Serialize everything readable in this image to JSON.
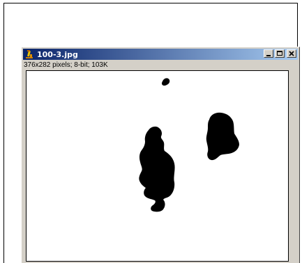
{
  "window": {
    "title": "100-3.jpg",
    "info": "376x282 pixels; 8-bit; 103K",
    "controls": {
      "minimize_icon": "minimize-icon",
      "maximize_icon": "maximize-icon",
      "close_icon": "close-icon"
    },
    "app_icon": "imagej-microscope-icon"
  },
  "colors": {
    "titlebar_start": "#0a246a",
    "titlebar_end": "#a6caf0",
    "window_bg": "#d4d0c8",
    "image_bg": "#ffffff",
    "blobs": "#000000"
  }
}
